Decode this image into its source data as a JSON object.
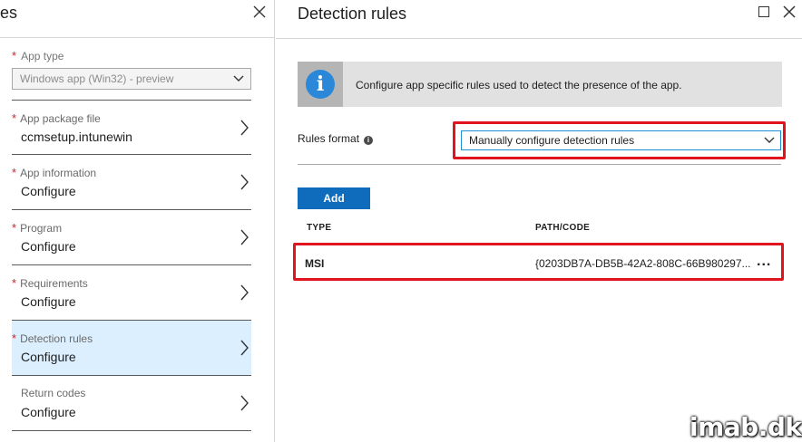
{
  "left_blade": {
    "title": "es",
    "app_type": {
      "label": "App type",
      "value": "Windows app (Win32) - preview"
    },
    "steps": [
      {
        "label": "App package file",
        "value": "ccmsetup.intunewin",
        "required": true
      },
      {
        "label": "App information",
        "value": "Configure",
        "required": true
      },
      {
        "label": "Program",
        "value": "Configure",
        "required": true
      },
      {
        "label": "Requirements",
        "value": "Configure",
        "required": true
      },
      {
        "label": "Detection rules",
        "value": "Configure",
        "required": true
      },
      {
        "label": "Return codes",
        "value": "Configure",
        "required": false
      }
    ],
    "required_mark": "*"
  },
  "right_blade": {
    "title": "Detection rules",
    "info_banner": {
      "icon": "info-icon",
      "icon_glyph": "i",
      "text": "Configure app specific rules used to detect the presence of the app."
    },
    "rules_format": {
      "label": "Rules format",
      "info_glyph": "i",
      "value": "Manually configure detection rules"
    },
    "add_label": "Add",
    "table": {
      "headers": {
        "type": "TYPE",
        "path": "PATH/CODE"
      },
      "rows": [
        {
          "type": "MSI",
          "path": "{0203DB7A-DB5B-42A2-808C-66B980297...",
          "more": "..."
        }
      ]
    }
  },
  "watermark": "imab.dk",
  "colors": {
    "accent": "#0f6cbd",
    "highlight": "#e0141e",
    "active_step": "#dcefff",
    "required": "#c4262e"
  }
}
